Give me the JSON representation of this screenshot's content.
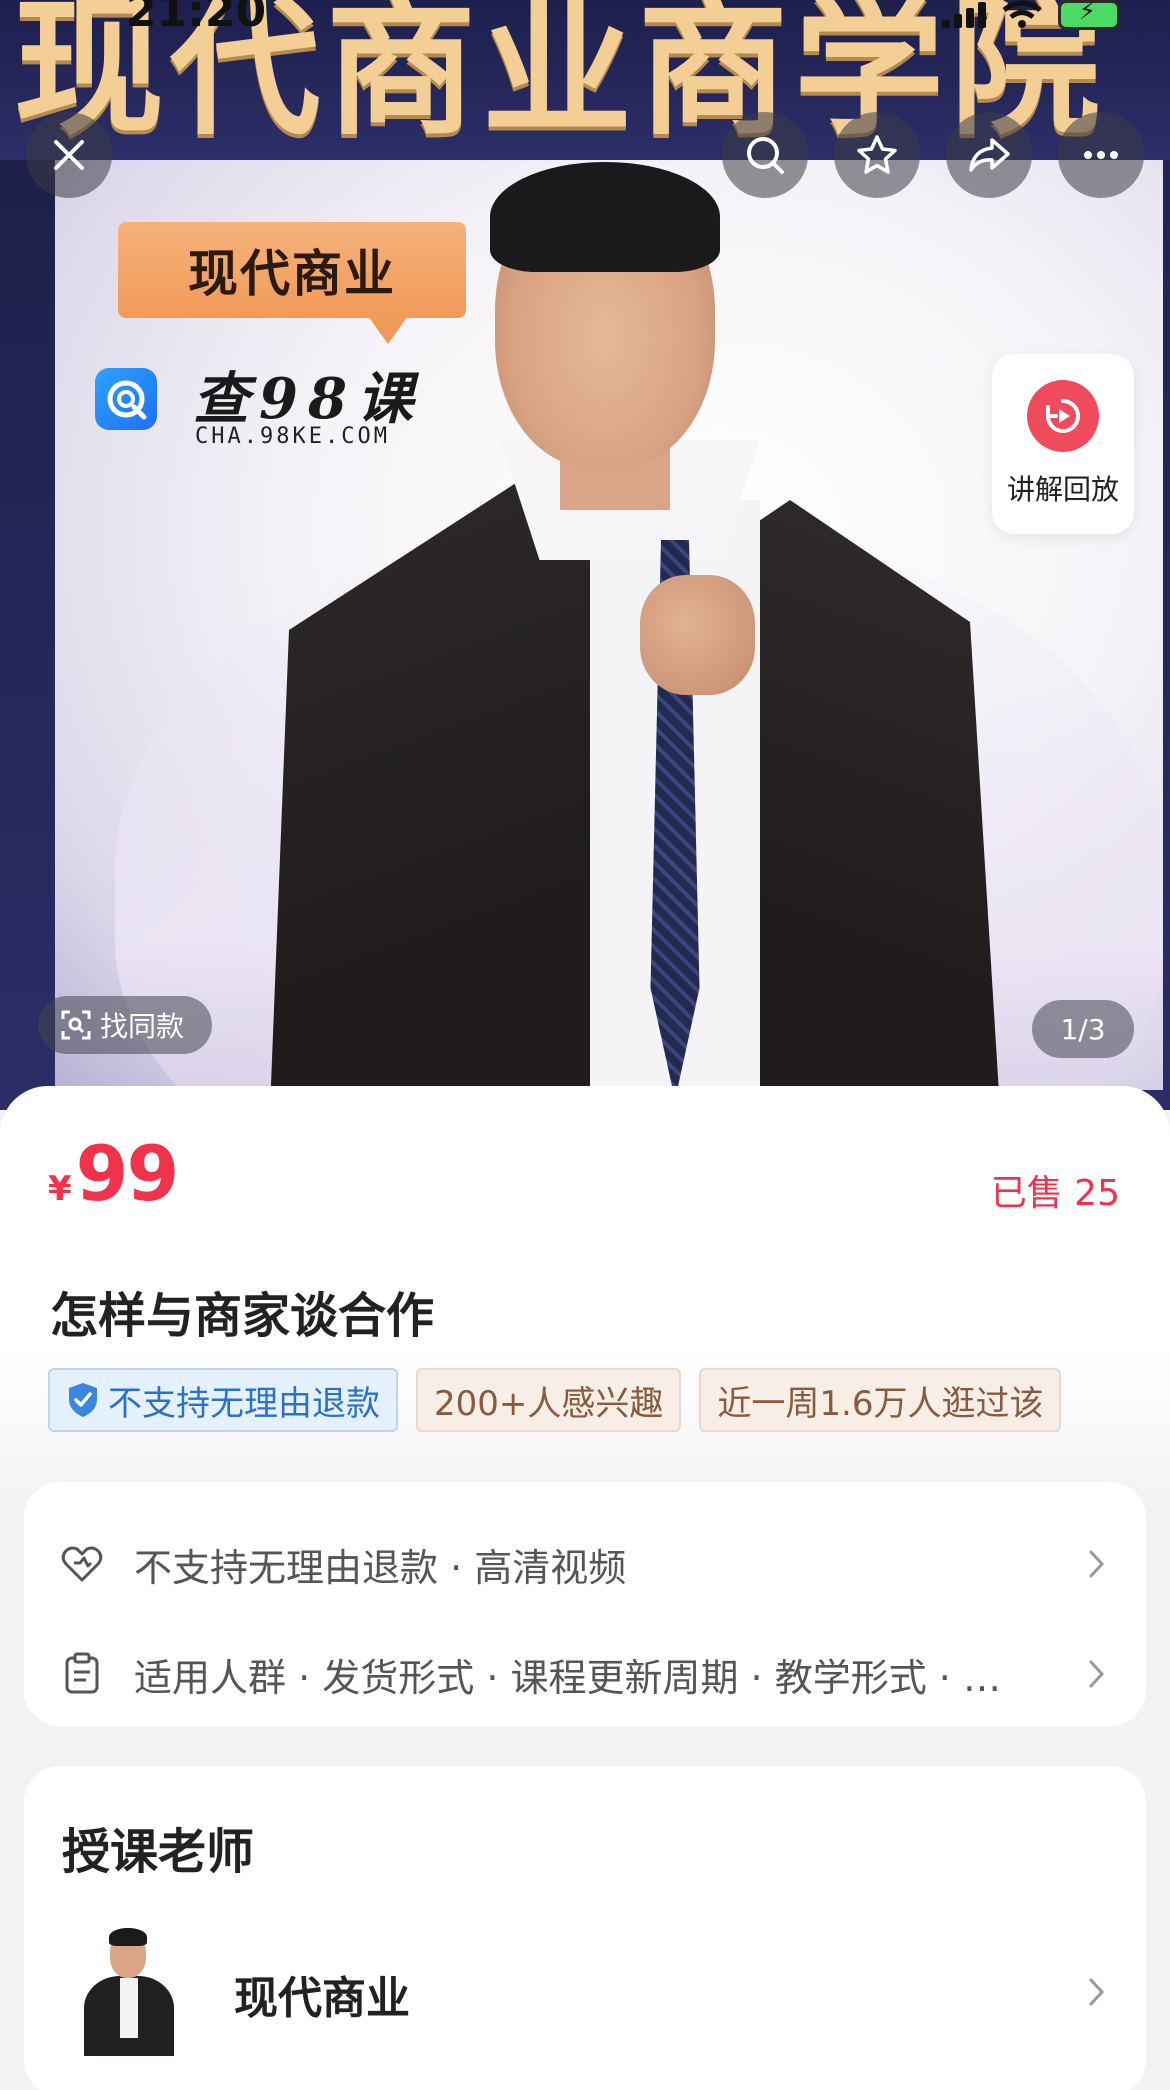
{
  "status_bar": {
    "time": "21:20"
  },
  "hero": {
    "banner_text": "现代商业商学院",
    "tag_bubble": "现代商业",
    "watermark": {
      "title": "查98课",
      "url": "CHA.98KE.COM"
    },
    "replay_label": "讲解回放",
    "find_same_label": "找同款",
    "page_indicator": "1/3",
    "icons": {
      "close": "close-icon",
      "search": "search-icon",
      "favorite": "star-icon",
      "share": "share-icon",
      "more": "more-icon",
      "replay": "replay-icon",
      "find_same": "scan-icon"
    }
  },
  "product": {
    "price_symbol": "¥",
    "price": "99",
    "sold": "已售 25",
    "title": "怎样与商家谈合作",
    "chips": [
      {
        "label": "不支持无理由退款",
        "style": "blue"
      },
      {
        "label": "200+人感兴趣",
        "style": "tan"
      },
      {
        "label": "近一周1.6万人逛过该",
        "style": "tan"
      }
    ]
  },
  "info_card": {
    "rows": [
      {
        "text": "不支持无理由退款 · 高清视频",
        "icon": "heart-shield-icon"
      },
      {
        "text": "适用人群 · 发货形式 · 课程更新周期 · 教学形式 · …",
        "icon": "clipboard-icon"
      }
    ]
  },
  "teacher_card": {
    "heading": "授课老师",
    "name": "现代商业"
  },
  "colors": {
    "price_red": "#f0334a",
    "chip_blue": "#2a72c8",
    "chip_tan": "#8a5a3c",
    "banner_gold": "#f3cf95",
    "banner_navy": "#1f2250"
  }
}
